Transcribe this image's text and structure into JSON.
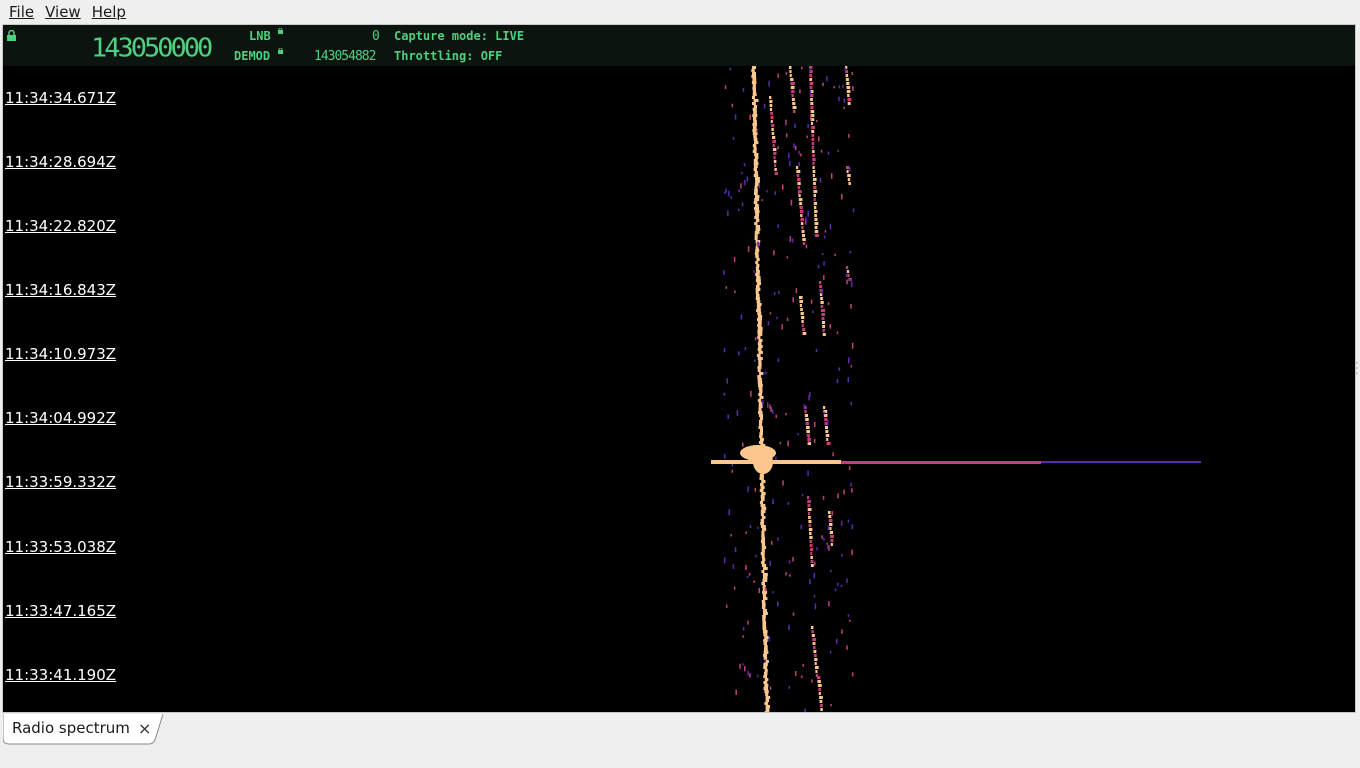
{
  "menu": {
    "file": "File",
    "view": "View",
    "help": "Help"
  },
  "status": {
    "main_frequency": "143050000",
    "lnb_label": "LNB",
    "lnb_value": "0",
    "demod_label": "DEMOD",
    "demod_value": "143054882",
    "capture_mode": "Capture mode: LIVE",
    "throttling": "Throttling: OFF"
  },
  "waterfall": {
    "timestamps": [
      "11:34:34.671Z",
      "11:34:28.694Z",
      "11:34:22.820Z",
      "11:34:16.843Z",
      "11:34:10.973Z",
      "11:34:04.992Z",
      "11:33:59.332Z",
      "11:33:53.038Z",
      "11:33:47.165Z",
      "11:33:41.190Z"
    ],
    "colors": {
      "background": "#000000",
      "hot": "#fcc78d",
      "mid": "#c2407a",
      "low": "#5b2bb0"
    }
  },
  "tabs": [
    {
      "label": "Radio spectrum",
      "close": "×"
    }
  ]
}
